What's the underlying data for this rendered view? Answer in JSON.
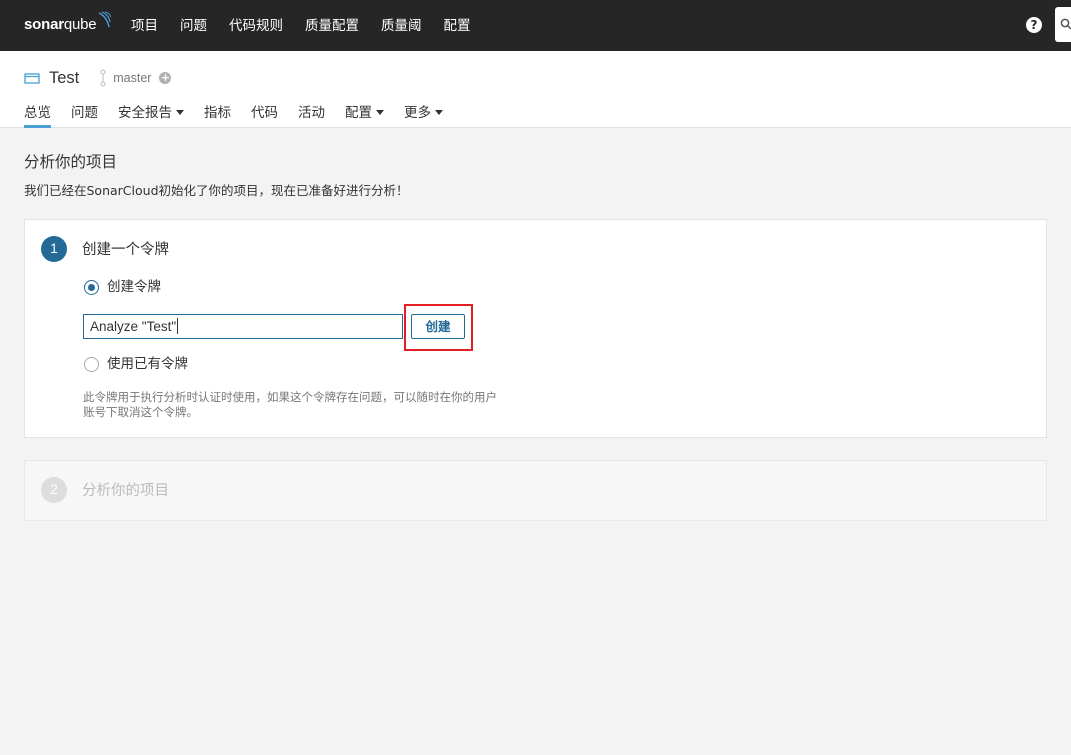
{
  "topbar": {
    "logo_bold": "sonar",
    "logo_light": "qube",
    "nav": [
      "项目",
      "问题",
      "代码规则",
      "质量配置",
      "质量阈",
      "配置"
    ],
    "help_icon": "question-circle-icon",
    "search_icon": "search-icon"
  },
  "project": {
    "name": "Test",
    "branch": "master",
    "icon": "project-icon",
    "branch_icon": "branch-icon",
    "add_icon": "plus-circle-icon"
  },
  "subnav": {
    "items": [
      {
        "label": "总览",
        "active": true,
        "dropdown": false
      },
      {
        "label": "问题",
        "active": false,
        "dropdown": false
      },
      {
        "label": "安全报告",
        "active": false,
        "dropdown": true
      },
      {
        "label": "指标",
        "active": false,
        "dropdown": false
      },
      {
        "label": "代码",
        "active": false,
        "dropdown": false
      },
      {
        "label": "活动",
        "active": false,
        "dropdown": false
      },
      {
        "label": "配置",
        "active": false,
        "dropdown": true
      },
      {
        "label": "更多",
        "active": false,
        "dropdown": true
      }
    ]
  },
  "main": {
    "title": "分析你的项目",
    "subtitle": "我们已经在SonarCloud初始化了你的项目，现在已准备好进行分析！"
  },
  "step1": {
    "number": "1",
    "title": "创建一个令牌",
    "option_create": "创建令牌",
    "token_value": "Analyze \"Test\"",
    "create_button": "创建",
    "option_existing": "使用已有令牌",
    "note_line1": "此令牌用于执行分析时认证时使用，如果这个令牌存在问题，可以随时在你的用户",
    "note_line2": "账号下取消这个令牌。"
  },
  "step2": {
    "number": "2",
    "title": "分析你的项目"
  },
  "colors": {
    "topbar_bg": "#262626",
    "accent": "#236a97",
    "active_tab": "#4b9fd5",
    "highlight": "#e31f26"
  }
}
